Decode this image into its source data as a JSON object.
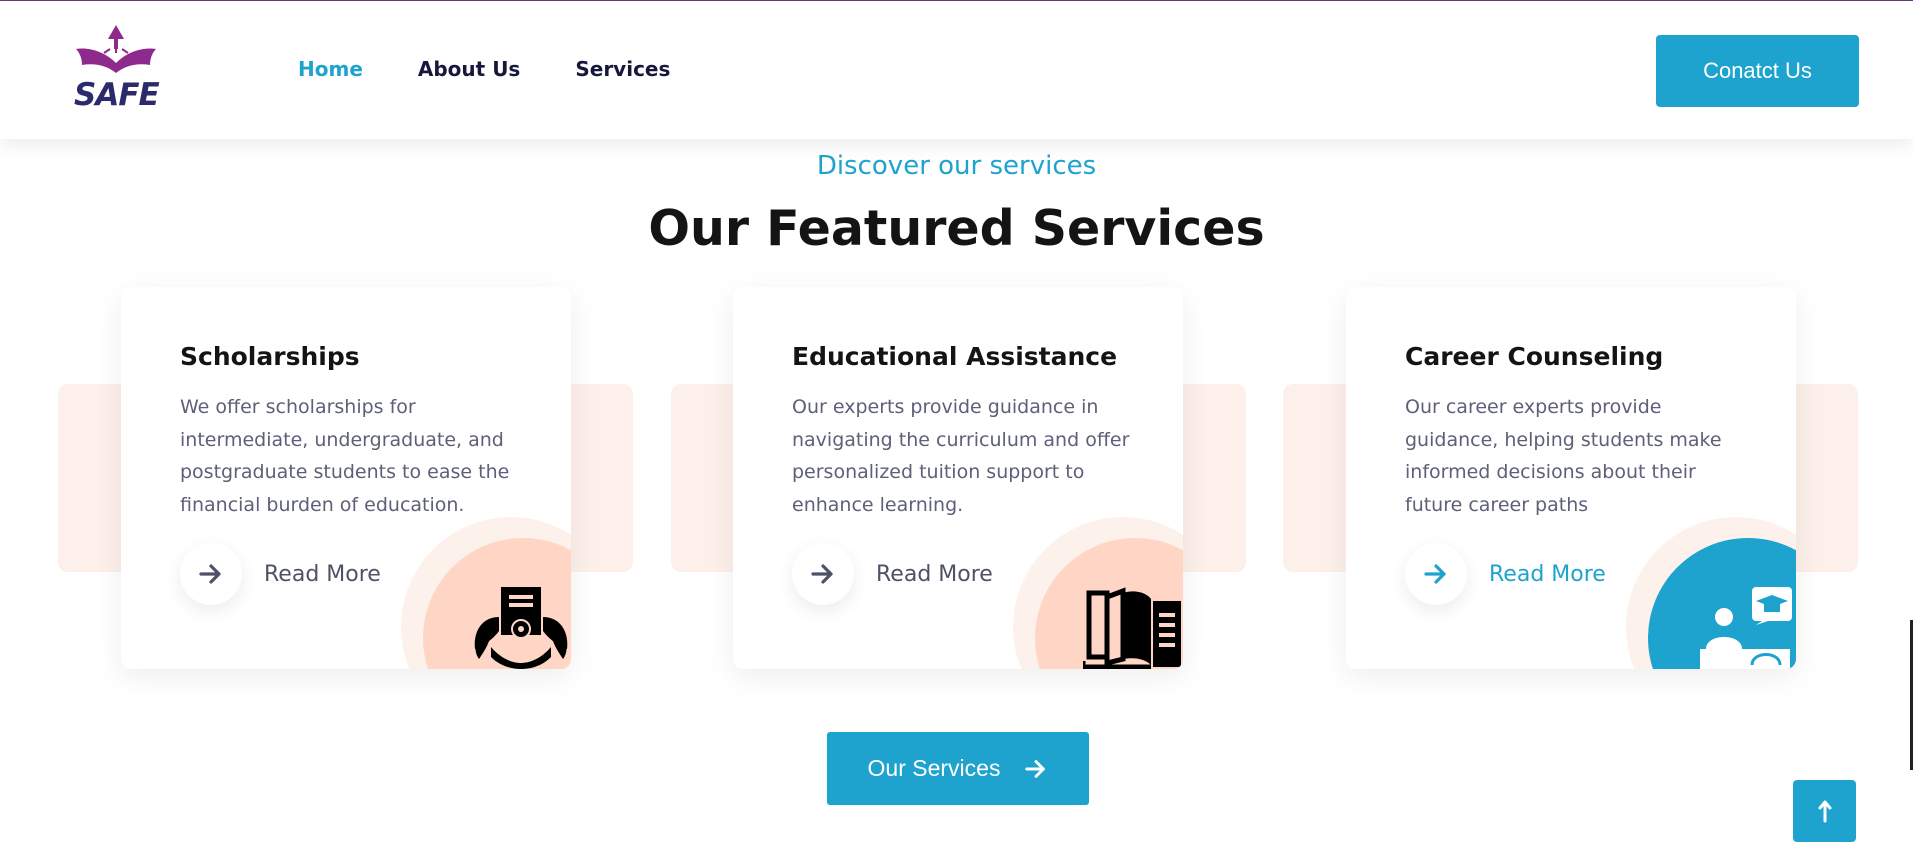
{
  "brand": {
    "logo_text": "SAFE",
    "primary_color": "#1ea3cf",
    "logo_color": "#8e2a8e",
    "peach": "#ffd6c6"
  },
  "nav": {
    "items": [
      {
        "label": "Home",
        "active": true
      },
      {
        "label": "About Us",
        "active": false
      },
      {
        "label": "Services",
        "active": false
      }
    ]
  },
  "header": {
    "contact_label": "Conatct Us"
  },
  "section": {
    "eyebrow": "Discover our services",
    "title": "Our Featured Services"
  },
  "services": [
    {
      "title": "Scholarships",
      "description": "We offer scholarships for intermediate, undergraduate, and postgraduate students to ease the financial burden of education.",
      "cta": "Read More",
      "icon": "scholarship-crest-icon"
    },
    {
      "title": "Educational Assistance",
      "description": "Our experts provide guidance in navigating the curriculum and offer personalized tuition support to enhance learning.",
      "cta": "Read More",
      "icon": "open-book-icon"
    },
    {
      "title": "Career Counseling",
      "description": "Our career experts provide guidance, helping students make informed decisions about their future career paths",
      "cta": "Read More",
      "icon": "counseling-graduate-icon"
    }
  ],
  "footer_cta": {
    "label": "Our Services"
  },
  "scroll_top": {
    "icon": "arrow-up-icon"
  }
}
